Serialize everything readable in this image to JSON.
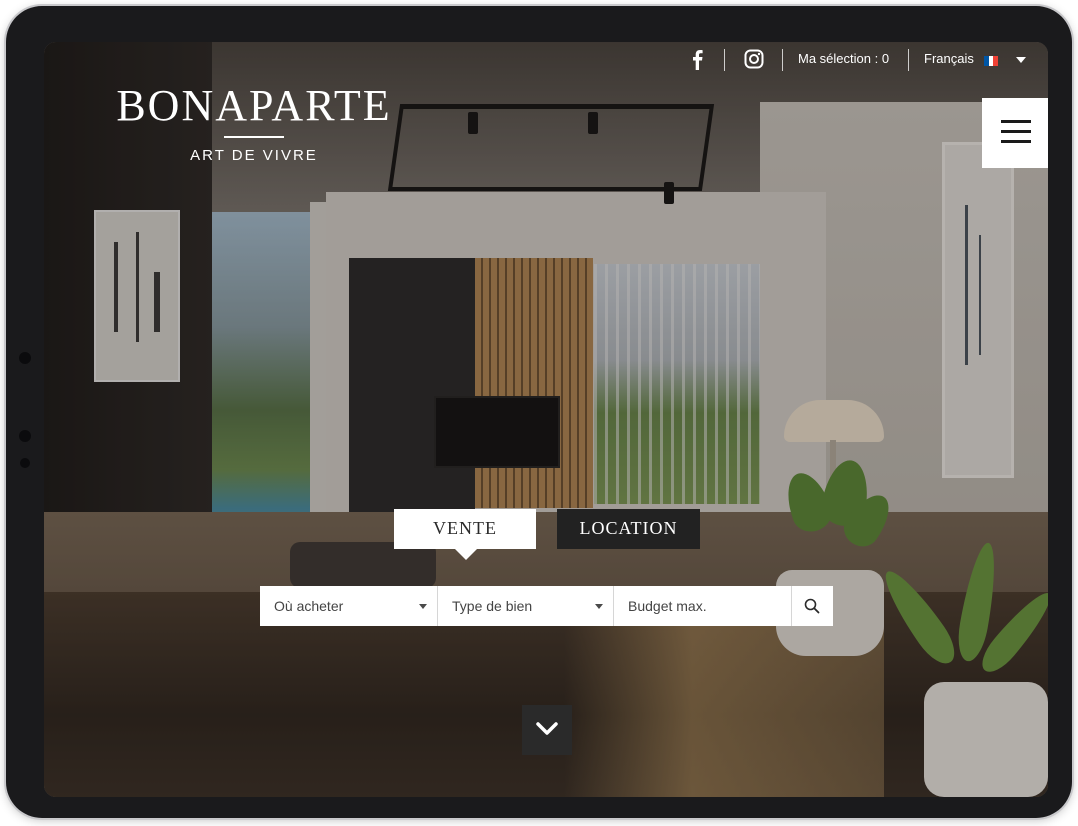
{
  "topbar": {
    "selection_label": "Ma sélection : 0",
    "language_label": "Français",
    "social": [
      "facebook-icon",
      "instagram-icon"
    ]
  },
  "logo": {
    "title": "BONAPARTE",
    "subtitle": "ART DE VIVRE"
  },
  "menu": {
    "icon": "hamburger-menu-icon"
  },
  "tabs": [
    {
      "label": "VENTE",
      "active": true
    },
    {
      "label": "LOCATION",
      "active": false
    }
  ],
  "search": {
    "where": {
      "label": "Où acheter"
    },
    "type": {
      "label": "Type de bien"
    },
    "budget": {
      "placeholder": "Budget max."
    },
    "button_icon": "search-icon"
  },
  "scroll": {
    "icon": "chevron-down-icon"
  },
  "colors": {
    "dark": "#222222",
    "white": "#ffffff",
    "flag_blue": "#0055a4",
    "flag_white": "#ffffff",
    "flag_red": "#ef4135"
  }
}
